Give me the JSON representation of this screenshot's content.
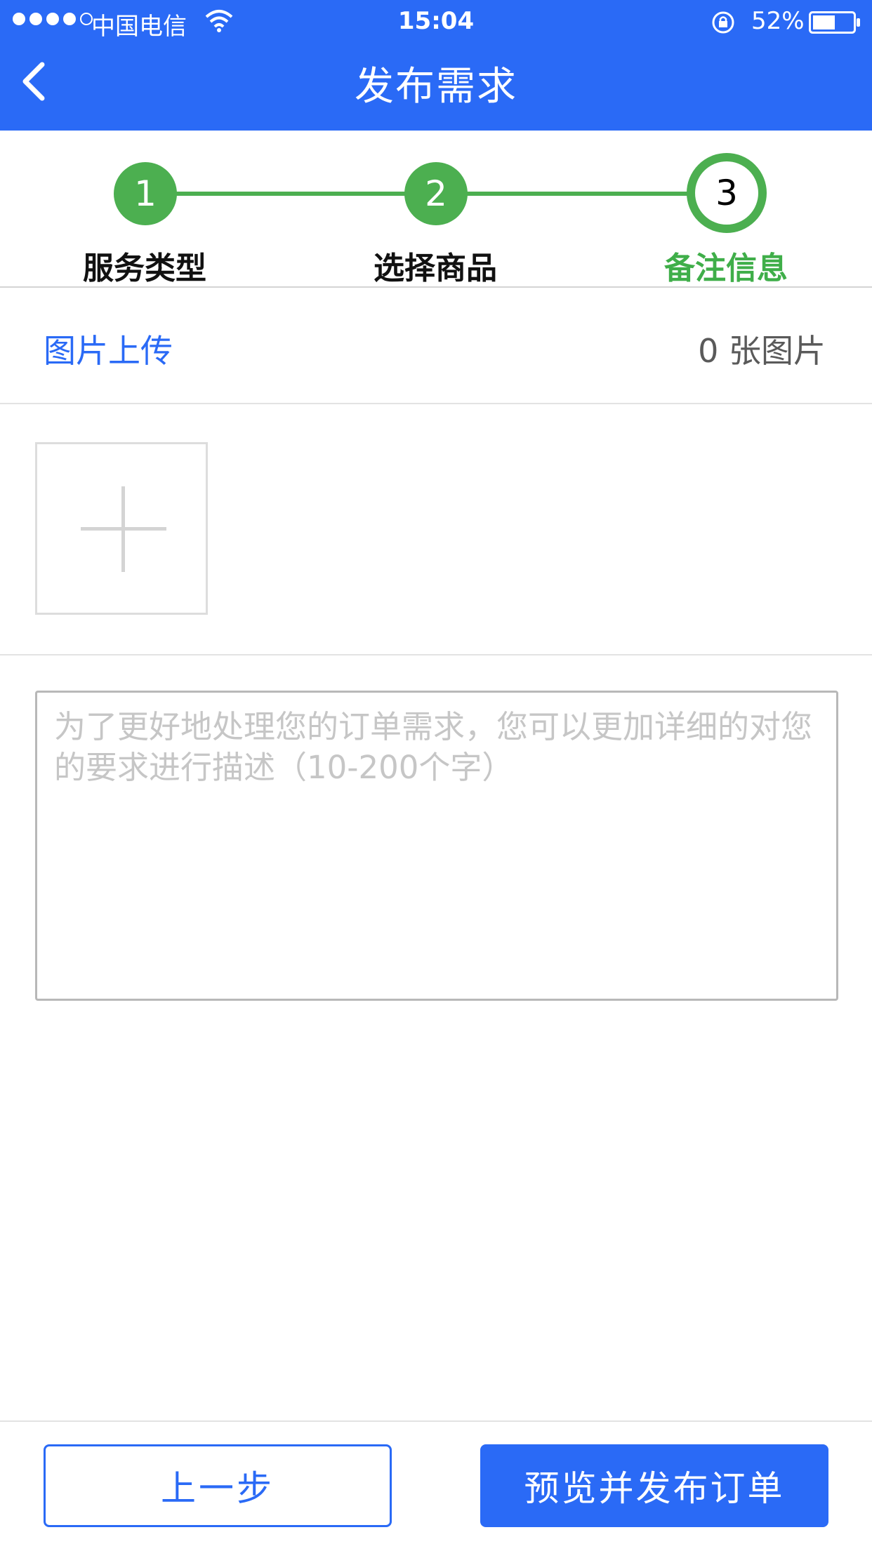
{
  "status_bar": {
    "carrier": "中国电信",
    "time": "15:04",
    "battery": "52%",
    "signal_dots": 4,
    "signal_total": 5
  },
  "nav": {
    "title": "发布需求",
    "back_icon": "chevron-left-icon"
  },
  "stepper": {
    "steps": [
      {
        "number": "1",
        "label": "服务类型",
        "state": "done"
      },
      {
        "number": "2",
        "label": "选择商品",
        "state": "done"
      },
      {
        "number": "3",
        "label": "备注信息",
        "state": "current"
      }
    ],
    "accent_color": "#4caf50"
  },
  "upload": {
    "title": "图片上传",
    "count_text": "0 张图片",
    "add_icon": "plus-icon"
  },
  "description": {
    "value": "",
    "placeholder": "为了更好地处理您的订单需求，您可以更加详细的对您的要求进行描述（10-200个字）"
  },
  "actions": {
    "prev_label": "上一步",
    "publish_label": "预览并发布订单"
  },
  "colors": {
    "primary": "#2a6af6",
    "step_green": "#4caf50"
  }
}
